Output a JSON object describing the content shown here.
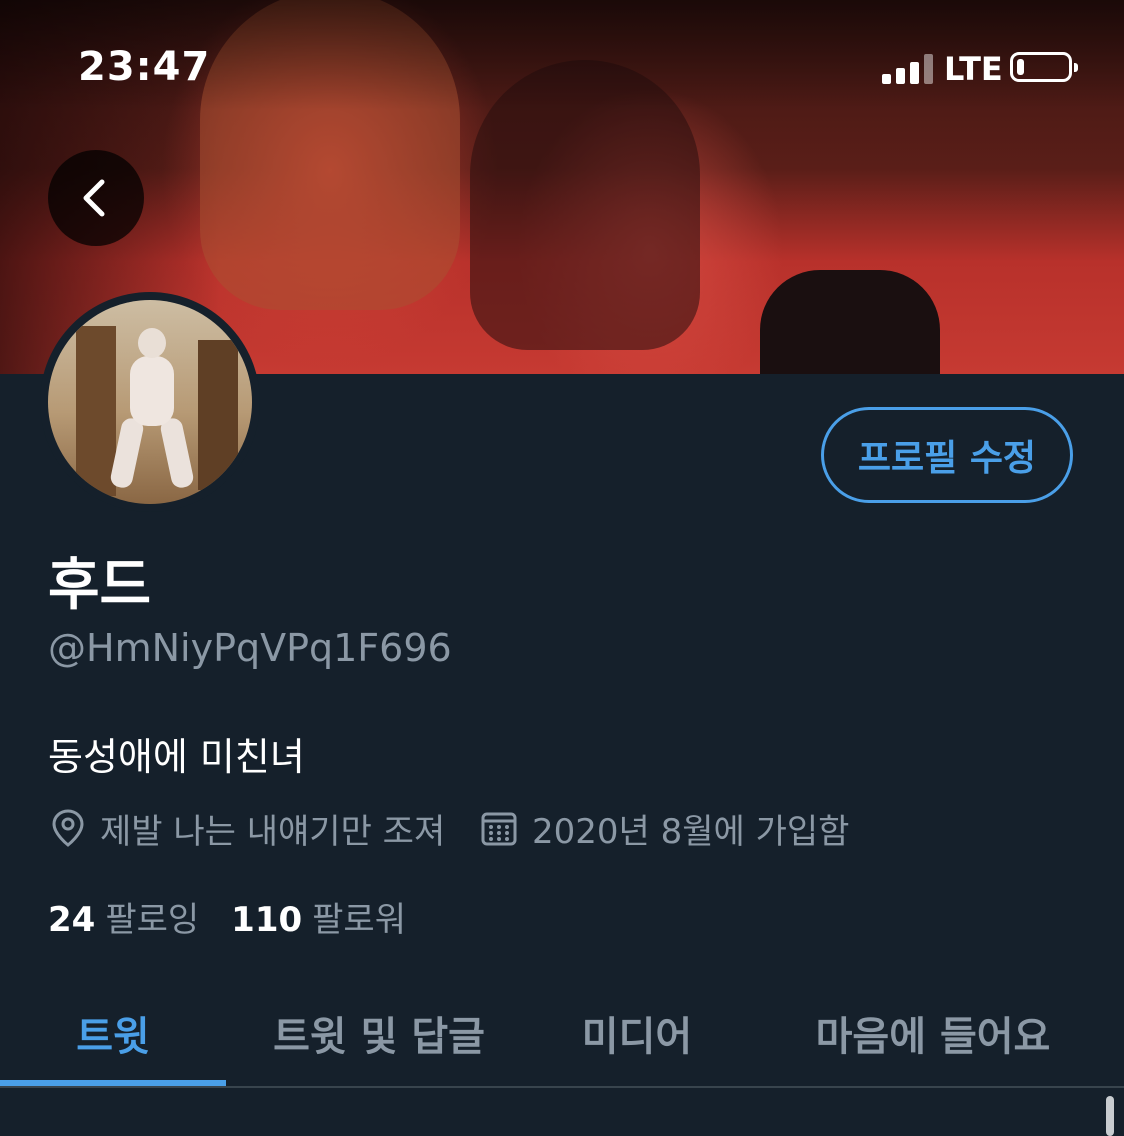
{
  "status_bar": {
    "time": "23:47",
    "network": "LTE",
    "battery_level": 0.15
  },
  "icons": {
    "back": "chevron-left-icon",
    "location": "location-pin-icon",
    "calendar": "calendar-icon",
    "signal": "signal-bars-icon",
    "battery": "battery-icon"
  },
  "colors": {
    "background": "#15202b",
    "accent": "#4a9fe8",
    "secondary_text": "#8b98a5",
    "divider": "#38444d"
  },
  "profile": {
    "edit_button_label": "프로필 수정",
    "display_name": "후드",
    "handle": "@HmNiyPqVPq1F696",
    "bio": "동성애에 미친녀",
    "location": "제발 나는 내얘기만 조져",
    "joined": "2020년 8월에 가입함",
    "following_count": "24",
    "following_label": "팔로잉",
    "followers_count": "110",
    "followers_label": "팔로워"
  },
  "tabs": [
    {
      "label": "트윗",
      "active": true
    },
    {
      "label": "트윗 및 답글",
      "active": false
    },
    {
      "label": "미디어",
      "active": false
    },
    {
      "label": "마음에 들어요",
      "active": false
    }
  ]
}
